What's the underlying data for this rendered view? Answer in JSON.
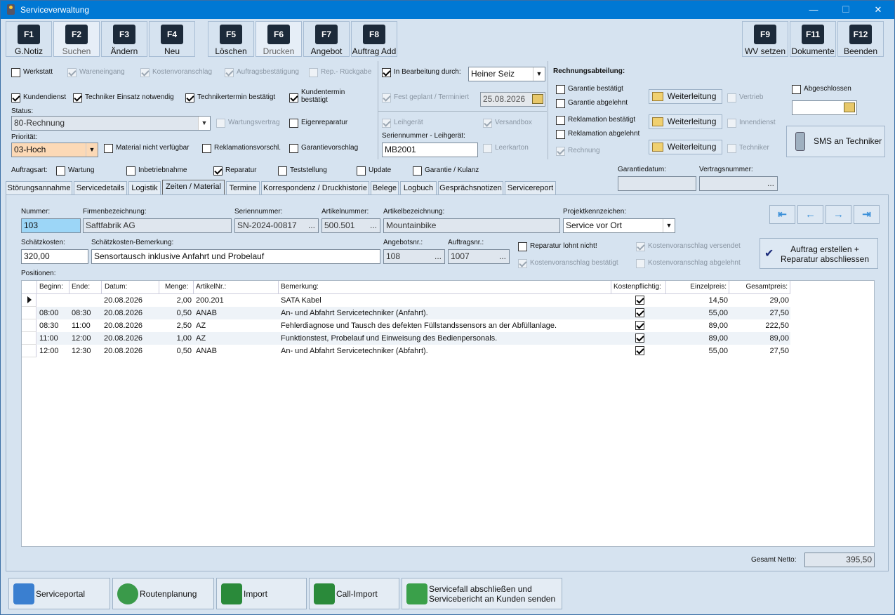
{
  "window": {
    "title": "Serviceverwaltung",
    "minimize": "—",
    "maximize": "☐",
    "close": "✕"
  },
  "fkeys": [
    {
      "key": "F1",
      "label": "G.Notiz"
    },
    {
      "key": "F2",
      "label": "Suchen"
    },
    {
      "key": "F3",
      "label": "Ändern"
    },
    {
      "key": "F4",
      "label": "Neu"
    },
    {
      "key": "F5",
      "label": "Löschen"
    },
    {
      "key": "F6",
      "label": "Drucken"
    },
    {
      "key": "F7",
      "label": "Angebot"
    },
    {
      "key": "F8",
      "label": "Auftrag Add"
    },
    {
      "key": "F9",
      "label": "WV setzen"
    },
    {
      "key": "F11",
      "label": "Dokumente"
    },
    {
      "key": "F12",
      "label": "Beenden"
    }
  ],
  "status_section": {
    "werkstatt": "Werkstatt",
    "wareneingang": "Wareneingang",
    "kostenvoranschlag": "Kostenvoranschlag",
    "auftragsbestaetigung": "Auftragsbestätigung",
    "rep_rueckgabe": "Rep.- Rückgabe",
    "kundendienst": "Kundendienst",
    "techniker_einsatz": "Techniker Einsatz notwendig",
    "technikertermin": "Technikertermin bestätigt",
    "kundentermin": "Kundentermin bestätigt",
    "status_label": "Status:",
    "status_value": "80-Rechnung",
    "wartungsvertrag": "Wartungsvertrag",
    "eigenreparatur": "Eigenreparatur",
    "prioritaet_label": "Priorität:",
    "prioritaet_value": "03-Hoch",
    "material": "Material nicht verfügbar",
    "reklamationsvorschl": "Reklamationsvorschl.",
    "garantievorschlag": "Garantievorschlag"
  },
  "bearbeitung": {
    "in_bearbeitung": "In Bearbeitung durch:",
    "bearbeiter": "Heiner Seiz",
    "fest_geplant": "Fest geplant / Terminiert",
    "datum": "25.08.2026",
    "leihgeraet": "Leihgerät",
    "versandbox": "Versandbox",
    "seriennummer_label": "Seriennummer - Leihgerät:",
    "seriennummer_value": "MB2001",
    "leerkarton": "Leerkarton"
  },
  "rechnung": {
    "title": "Rechnungsabteilung:",
    "garantie_bestaetigt": "Garantie bestätigt",
    "garantie_abgelehnt": "Garantie abgelehnt",
    "reklamation_bestaetigt": "Reklamation bestätigt",
    "reklamation_abgelehnt": "Reklamation abgelehnt",
    "rechnung": "Rechnung",
    "weiterleitung": "Weiterleitung",
    "vertrieb": "Vertrieb",
    "innendienst": "Innendienst",
    "techniker": "Techniker",
    "abgeschlossen": "Abgeschlossen",
    "sms": "SMS an Techniker"
  },
  "auftragsart": {
    "label": "Auftragsart:",
    "wartung": "Wartung",
    "inbetriebnahme": "Inbetriebnahme",
    "reparatur": "Reparatur",
    "teststellung": "Teststellung",
    "update": "Update",
    "garantie": "Garantie / Kulanz",
    "garantiedatum_label": "Garantiedatum:",
    "vertragsnummer_label": "Vertragsnummer:",
    "dots": "..."
  },
  "tabs": [
    "Störungsannahme",
    "Servicedetails",
    "Logistik",
    "Zeiten / Material",
    "Termine",
    "Korrespondenz / Druckhistorie",
    "Belege",
    "Logbuch",
    "Gesprächsnotizen",
    "Servicereport"
  ],
  "detail": {
    "nummer_label": "Nummer:",
    "nummer": "103",
    "firma_label": "Firmenbezeichnung:",
    "firma": "Saftfabrik AG",
    "serien_label": "Seriennummer:",
    "serien": "SN-2024-00817",
    "artikelnr_label": "Artikelnummer:",
    "artikelnr": "500.501",
    "artikelbez_label": "Artikelbezeichnung:",
    "artikelbez": "Mountainbike",
    "projekt_label": "Projektkennzeichen:",
    "projekt": "Service vor Ort",
    "schaetz_label": "Schätzkosten:",
    "schaetz": "320,00",
    "schaetz_bem_label": "Schätzkosten-Bemerkung:",
    "schaetz_bem": "Sensortausch inklusive Anfahrt und Probelauf",
    "angebot_label": "Angebotsnr.:",
    "angebot": "108",
    "auftrag_label": "Auftragsnr.:",
    "auftrag": "1007",
    "rep_lohnt": "Reparatur lohnt nicht!",
    "kva_versendet": "Kostenvoranschlag versendet",
    "kva_bestaetigt": "Kostenvoranschlag bestätigt",
    "kva_abgelehnt": "Kostenvoranschlag abgelehnt",
    "auftrag_btn": "Auftrag erstellen + Reparatur abschliessen",
    "positionen_label": "Positionen:",
    "dots": "..."
  },
  "grid": {
    "headers": [
      "Beginn:",
      "Ende:",
      "Datum:",
      "Menge:",
      "ArtikelNr.:",
      "Bemerkung:",
      "Kostenpflichtig:",
      "Einzelpreis:",
      "Gesamtpreis:"
    ],
    "rows": [
      {
        "beginn": "",
        "ende": "",
        "datum": "20.08.2026",
        "menge": "2,00",
        "artikel": "200.201",
        "bemerkung": "SATA Kabel",
        "einzel": "14,50",
        "gesamt": "29,00"
      },
      {
        "beginn": "08:00",
        "ende": "08:30",
        "datum": "20.08.2026",
        "menge": "0,50",
        "artikel": "ANAB",
        "bemerkung": "An- und Abfahrt Servicetechniker (Anfahrt).",
        "einzel": "55,00",
        "gesamt": "27,50"
      },
      {
        "beginn": "08:30",
        "ende": "11:00",
        "datum": "20.08.2026",
        "menge": "2,50",
        "artikel": "AZ",
        "bemerkung": "Fehlerdiagnose und Tausch des defekten Füllstandssensors an der Abfüllanlage.",
        "einzel": "89,00",
        "gesamt": "222,50"
      },
      {
        "beginn": "11:00",
        "ende": "12:00",
        "datum": "20.08.2026",
        "menge": "1,00",
        "artikel": "AZ",
        "bemerkung": "Funktionstest, Probelauf und Einweisung des Bedienpersonals.",
        "einzel": "89,00",
        "gesamt": "89,00"
      },
      {
        "beginn": "12:00",
        "ende": "12:30",
        "datum": "20.08.2026",
        "menge": "0,50",
        "artikel": "ANAB",
        "bemerkung": "An- und Abfahrt Servicetechniker (Abfahrt).",
        "einzel": "55,00",
        "gesamt": "27,50"
      }
    ]
  },
  "total": {
    "label": "Gesamt Netto:",
    "value": "395,50"
  },
  "bottom": [
    "Serviceportal",
    "Routenplanung",
    "Import",
    "Call-Import",
    "Servicefall abschließen und Servicebericht an Kunden senden"
  ]
}
